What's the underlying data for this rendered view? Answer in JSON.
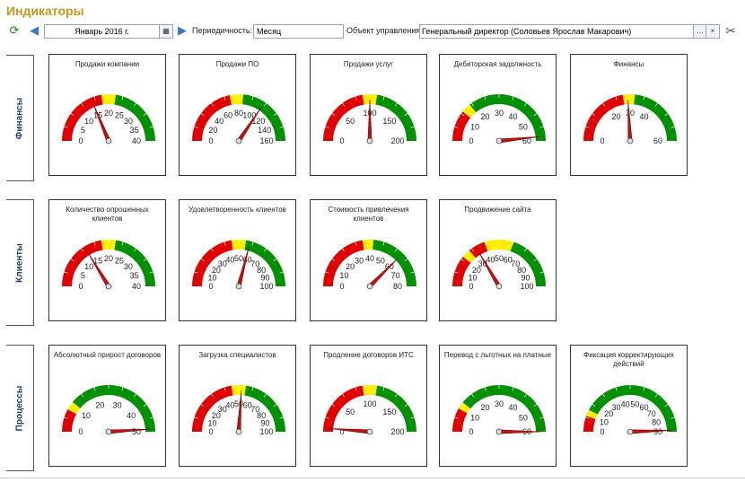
{
  "window": {
    "title": "Индикаторы"
  },
  "toolbar": {
    "refresh_icon": "refresh-icon",
    "period_value": "Январь 2016 г.",
    "periodicity_label": "Периодичность:",
    "periodicity_value": "Месяц",
    "object_label": "Объект управления:",
    "object_value": "Генеральный директор (Соловьев Ярослав Макарович)",
    "select_btn": "...",
    "clear_btn": "×"
  },
  "groups": [
    {
      "label": "Финансы"
    },
    {
      "label": "Клиенты"
    },
    {
      "label": "Процессы"
    }
  ],
  "colors": {
    "red": "#e00000",
    "yellow": "#ffee00",
    "green": "#009000",
    "title": "#c8941c",
    "group": "#1f3f6e",
    "needle": "#c01010"
  },
  "gauges": [
    {
      "title": "Продажи компании",
      "min": 0,
      "max": 40,
      "ticks": [
        0,
        5,
        10,
        15,
        20,
        25,
        30,
        35,
        40
      ],
      "zones": [
        [
          0,
          18,
          "red"
        ],
        [
          18,
          22,
          "yellow"
        ],
        [
          22,
          40,
          "green"
        ]
      ],
      "value": 15
    },
    {
      "title": "Продажи ПО",
      "min": 0,
      "max": 160,
      "ticks": [
        0,
        20,
        40,
        60,
        80,
        100,
        120,
        140,
        160
      ],
      "zones": [
        [
          0,
          70,
          "red"
        ],
        [
          70,
          85,
          "yellow"
        ],
        [
          85,
          160,
          "green"
        ]
      ],
      "value": 110
    },
    {
      "title": "Продажи услуг",
      "min": 0,
      "max": 200,
      "ticks": [
        0,
        50,
        100,
        150,
        200
      ],
      "zones": [
        [
          0,
          90,
          "red"
        ],
        [
          90,
          110,
          "yellow"
        ],
        [
          110,
          200,
          "green"
        ]
      ],
      "value": 100
    },
    {
      "title": "Дебиторская задолжность",
      "min": 0,
      "max": 60,
      "ticks": [
        0,
        10,
        20,
        30,
        40,
        50,
        60
      ],
      "zones": [
        [
          0,
          13,
          "red"
        ],
        [
          13,
          17,
          "yellow"
        ],
        [
          17,
          60,
          "green"
        ]
      ],
      "value": 58
    },
    {
      "title": "Финансы",
      "min": 0,
      "max": 60,
      "ticks": [
        0,
        20,
        30,
        40,
        60
      ],
      "zones": [
        [
          0,
          27,
          "red"
        ],
        [
          27,
          32,
          "yellow"
        ],
        [
          32,
          60,
          "green"
        ]
      ],
      "value": 29
    },
    {
      "title": "Количество опрошенных клиентов",
      "min": 0,
      "max": 40,
      "ticks": [
        0,
        5,
        10,
        15,
        20,
        25,
        30,
        35,
        40
      ],
      "zones": [
        [
          0,
          18,
          "red"
        ],
        [
          18,
          22,
          "yellow"
        ],
        [
          22,
          40,
          "green"
        ]
      ],
      "value": 13
    },
    {
      "title": "Удовлетворенность клиентов",
      "min": 0,
      "max": 100,
      "ticks": [
        0,
        10,
        20,
        30,
        40,
        50,
        60,
        70,
        80,
        90,
        100
      ],
      "zones": [
        [
          0,
          45,
          "red"
        ],
        [
          45,
          55,
          "yellow"
        ],
        [
          55,
          100,
          "green"
        ]
      ],
      "value": 58
    },
    {
      "title": "Стоимость привлечения клиентов",
      "min": 0,
      "max": 80,
      "ticks": [
        0,
        10,
        20,
        30,
        40,
        50,
        60,
        70,
        80
      ],
      "zones": [
        [
          0,
          36,
          "red"
        ],
        [
          36,
          42,
          "yellow"
        ],
        [
          42,
          80,
          "green"
        ]
      ],
      "value": 60
    },
    {
      "title": "Продвижение сайта",
      "min": 0,
      "max": 100,
      "ticks": [
        0,
        10,
        20,
        30,
        40,
        50,
        60,
        70,
        80,
        90,
        100
      ],
      "zones": [
        [
          0,
          22,
          "red"
        ],
        [
          22,
          28,
          "yellow"
        ],
        [
          28,
          40,
          "red"
        ],
        [
          40,
          60,
          "yellow"
        ],
        [
          60,
          100,
          "green"
        ]
      ],
      "value": 33
    },
    {
      "title": "Абсолютный прирост договоров",
      "min": 0,
      "max": 50,
      "ticks": [
        0,
        10,
        20,
        30,
        40,
        50
      ],
      "zones": [
        [
          0,
          8,
          "red"
        ],
        [
          8,
          11,
          "yellow"
        ],
        [
          11,
          50,
          "green"
        ]
      ],
      "value": 49
    },
    {
      "title": "Загрузка специалистов",
      "min": 0,
      "max": 100,
      "ticks": [
        0,
        10,
        20,
        30,
        40,
        50,
        60,
        70,
        80,
        90,
        100
      ],
      "zones": [
        [
          0,
          45,
          "red"
        ],
        [
          45,
          55,
          "yellow"
        ],
        [
          55,
          100,
          "green"
        ]
      ],
      "value": 52
    },
    {
      "title": "Продление договоров ИТС",
      "min": 0,
      "max": 200,
      "ticks": [
        0,
        50,
        100,
        150,
        200
      ],
      "zones": [
        [
          0,
          90,
          "red"
        ],
        [
          90,
          110,
          "yellow"
        ],
        [
          110,
          200,
          "green"
        ]
      ],
      "value": 5
    },
    {
      "title": "Перевод с льготных на платные",
      "min": 0,
      "max": 60,
      "ticks": [
        0,
        10,
        20,
        30,
        40,
        50,
        60
      ],
      "zones": [
        [
          0,
          10,
          "red"
        ],
        [
          10,
          13,
          "yellow"
        ],
        [
          13,
          60,
          "green"
        ]
      ],
      "value": 60
    },
    {
      "title": "Фиксация корректирующих действий",
      "min": 0,
      "max": 90,
      "ticks": [
        0,
        10,
        20,
        30,
        40,
        50,
        60,
        70,
        80,
        90
      ],
      "zones": [
        [
          0,
          10,
          "red"
        ],
        [
          10,
          14,
          "yellow"
        ],
        [
          14,
          90,
          "green"
        ]
      ],
      "value": 89
    }
  ]
}
